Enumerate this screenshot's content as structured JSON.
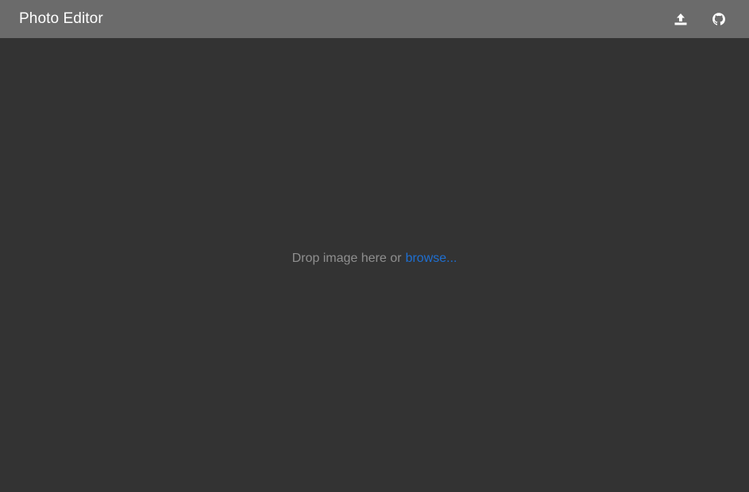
{
  "header": {
    "title": "Photo Editor",
    "icons": [
      "upload-icon",
      "github-icon"
    ]
  },
  "dropzone": {
    "prompt": "Drop image here or",
    "browse_label": "browse..."
  },
  "colors": {
    "header_bg": "#6b6b6b",
    "canvas_bg": "#333333",
    "link": "#1f6fd1",
    "prompt_text": "#8f8f8f"
  }
}
